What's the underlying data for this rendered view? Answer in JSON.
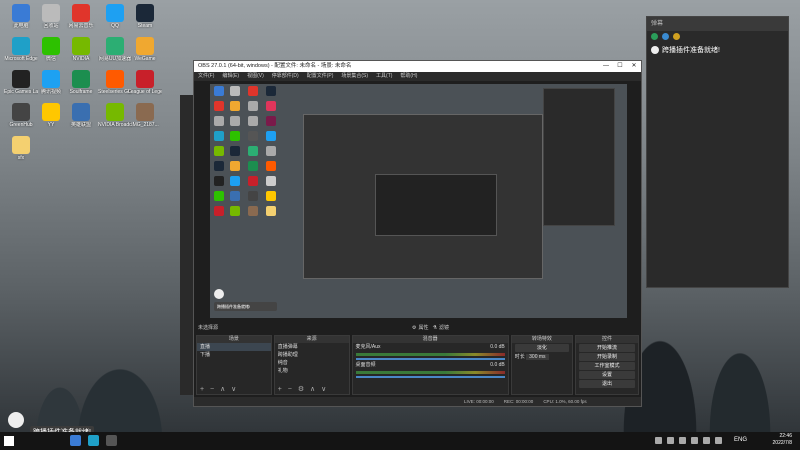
{
  "desktop": {
    "icons": [
      {
        "label": "此电脑",
        "color": "#3a7bd5"
      },
      {
        "label": "回收站",
        "color": "#bbbbbb"
      },
      {
        "label": "网易云音乐",
        "color": "#e0352b"
      },
      {
        "label": "QQ",
        "color": "#1ea0f2"
      },
      {
        "label": "Steam",
        "color": "#1b2838"
      },
      {
        "label": "Microsoft Edge",
        "color": "#1fa0c8"
      },
      {
        "label": "微信",
        "color": "#2dc100"
      },
      {
        "label": "NVIDIA",
        "color": "#76b900"
      },
      {
        "label": "网易UU加速器",
        "color": "#2cae73"
      },
      {
        "label": "WeGame",
        "color": "#f0a830"
      },
      {
        "label": "Epic Games Launcher",
        "color": "#222222"
      },
      {
        "label": "腾讯视频",
        "color": "#1da1f2"
      },
      {
        "label": "Soulframe",
        "color": "#1c8e4f"
      },
      {
        "label": "Steelseries GG",
        "color": "#ff5a00"
      },
      {
        "label": "League of Legends",
        "color": "#c8202a"
      },
      {
        "label": "GreenHub",
        "color": "#444444"
      },
      {
        "label": "YY",
        "color": "#ffc700"
      },
      {
        "label": "英雄联盟",
        "color": "#3a6fb0"
      },
      {
        "label": "NVIDIA Broadcast",
        "color": "#76b900"
      },
      {
        "label": "IMG_2187...",
        "color": "#8a6a50"
      },
      {
        "label": "sfx",
        "color": "#f4d070"
      }
    ]
  },
  "chat": {
    "header": "弹幕",
    "message": "跨播插件准备就绪!"
  },
  "obs": {
    "title": "OBS 27.0.1 (64-bit, windows) - 配置文件: 未命名 - 场景: 未命名",
    "menu": [
      "文件(F)",
      "编辑(E)",
      "视图(V)",
      "停靠部件(D)",
      "配置文件(P)",
      "场景集合(S)",
      "工具(T)",
      "帮助(H)"
    ],
    "preview_notification": "跨播插件准备就绪!",
    "scene_status": "未选择源",
    "properties_label": "属性",
    "filters_label": "滤镜",
    "docks": {
      "scenes": {
        "title": "场景",
        "items": [
          "直播",
          "下播"
        ]
      },
      "sources": {
        "title": "来源",
        "items": [
          "直播弹幕",
          "跨播助理",
          "纯音",
          "礼物"
        ]
      },
      "mixer": {
        "title": "混音器",
        "channels": [
          {
            "name": "麦克风/Aux",
            "db": "0.0 dB"
          },
          {
            "name": "桌面音频",
            "db": "0.0 dB"
          }
        ]
      },
      "transitions": {
        "title": "转场特效",
        "type": "淡化",
        "duration_label": "时长",
        "duration": "300 ms"
      },
      "controls": {
        "title": "控件",
        "buttons": [
          "开始推流",
          "开始录制",
          "工作室模式",
          "设置",
          "退出"
        ]
      }
    },
    "status": {
      "live": "LIVE: 00:00:00",
      "rec": "REC: 00:00:00",
      "cpu": "CPU: 1.0%, 60.00 fps"
    }
  },
  "desktop_notification": "跨播插件准备就绪!",
  "taskbar": {
    "time": "22:46",
    "date": "2022/7/8",
    "lang": "ENG"
  }
}
